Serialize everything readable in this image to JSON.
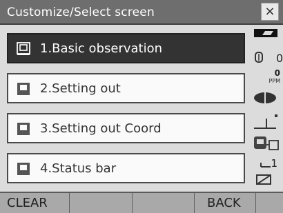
{
  "window": {
    "title": "Customize/Select screen",
    "close_label": "×"
  },
  "menu": {
    "items": [
      {
        "label": "1.Basic observation",
        "selected": true
      },
      {
        "label": "2.Setting out",
        "selected": false
      },
      {
        "label": "3.Setting out Coord",
        "selected": false
      },
      {
        "label": "4.Status bar",
        "selected": false
      }
    ]
  },
  "status": {
    "prism_constant": "0",
    "ppm_value": "0",
    "ppm_unit": "PPM",
    "display_count": "1",
    "icons": [
      "battery-icon",
      "prism-icon",
      "laser-icon",
      "tilt-icon",
      "communication-icon",
      "input-mode-icon"
    ]
  },
  "softkeys": [
    "CLEAR",
    "",
    "",
    "BACK",
    ""
  ]
}
